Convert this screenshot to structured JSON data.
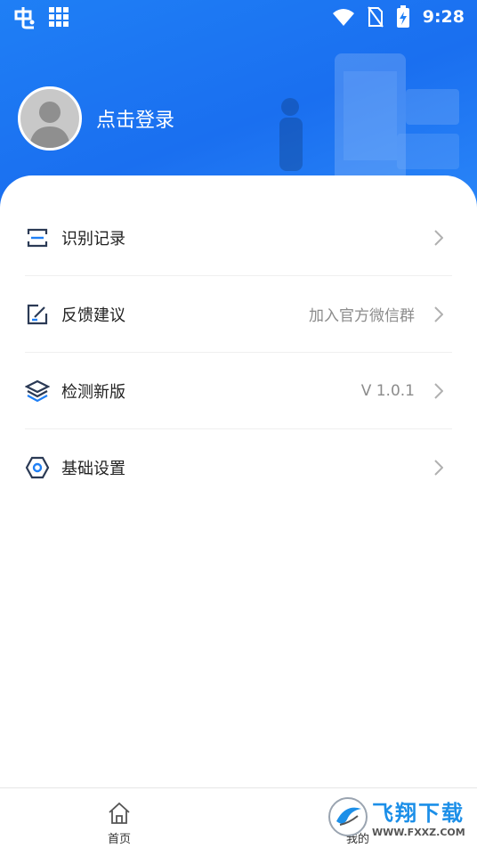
{
  "status_bar": {
    "time": "9:28"
  },
  "profile": {
    "login_label": "点击登录"
  },
  "menu": [
    {
      "label": "识别记录",
      "value": "",
      "icon": "scan-icon"
    },
    {
      "label": "反馈建议",
      "value": "加入官方微信群",
      "icon": "edit-icon"
    },
    {
      "label": "检测新版",
      "value": "V 1.0.1",
      "icon": "layers-icon"
    },
    {
      "label": "基础设置",
      "value": "",
      "icon": "settings-hexagon-icon"
    }
  ],
  "bottom_nav": {
    "home_label": "首页",
    "mine_label": "我的"
  },
  "watermark": {
    "title": "飞翔下载",
    "url": "WWW.FXXZ.COM"
  },
  "colors": {
    "header_blue": "#1f7ff5",
    "icon_dark": "#2b3a55",
    "accent_blue": "#1f7ff5"
  }
}
